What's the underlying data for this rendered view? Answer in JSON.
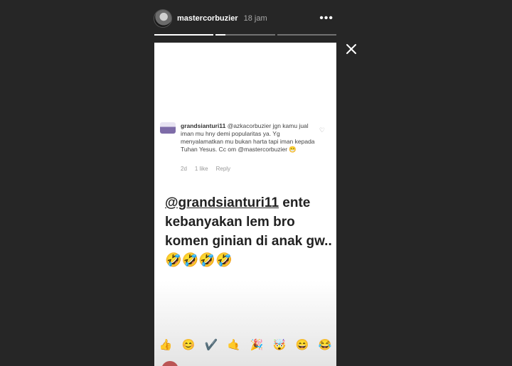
{
  "header": {
    "username": "mastercorbuzier",
    "timestamp": "18 jam"
  },
  "comment": {
    "username": "grandsianturi11",
    "text": "@azkacorbuzier jgn kamu jual iman mu hny demi popularitas ya. Yg menyalamatkan mu bukan harta tapi iman kepada Tuhan Yesus. Cc om @mastercorbuzier 😁",
    "age": "2d",
    "likes": "1 like",
    "reply": "Reply"
  },
  "caption": {
    "mention": "@grandsianturi11",
    "text": " ente kebanyakan lem bro komen ginian di anak gw.. 🤣🤣🤣🤣"
  },
  "quick_reactions": [
    "👍",
    "😊",
    "✔️",
    "🤙",
    "🎉",
    "🤯",
    "😄",
    "😂"
  ]
}
